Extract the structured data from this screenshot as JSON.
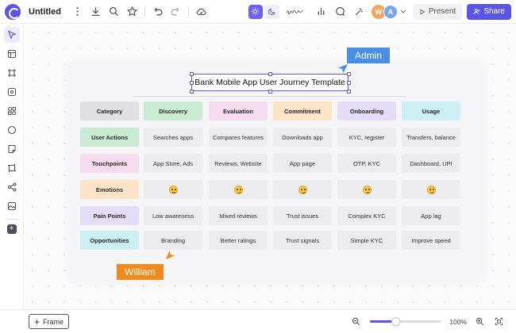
{
  "header": {
    "title": "Untitled",
    "present_label": "Present",
    "share_label": "Share",
    "avatars": [
      {
        "initial": "W",
        "color": "#f0a860"
      },
      {
        "initial": "A",
        "color": "#7aa6f0"
      }
    ]
  },
  "board": {
    "title": "Bank Mobile App User Journey Template",
    "columns": [
      {
        "label": "Category",
        "color": "#e0e0e3"
      },
      {
        "label": "Discovery",
        "color": "#c9ebd4"
      },
      {
        "label": "Evaluation",
        "color": "#f7dcef"
      },
      {
        "label": "Commitment",
        "color": "#fde3c8"
      },
      {
        "label": "Onboarding",
        "color": "#e5dcf7"
      },
      {
        "label": "Usage",
        "color": "#cdeff3"
      }
    ],
    "rows": [
      {
        "label": "User Actions",
        "color": "#c9ebd4",
        "cells": [
          "Searches apps",
          "Compares features",
          "Downloads app",
          "KYC, register",
          "Transfers, balance"
        ]
      },
      {
        "label": "Touchpoints",
        "color": "#f7dcef",
        "cells": [
          "App Store, Ads",
          "Reviews, Website",
          "App page",
          "OTP, KYC",
          "Dashboard, UPI"
        ]
      },
      {
        "label": "Emotions",
        "color": "#fde3c8",
        "emotions": [
          "think",
          "happy",
          "happy",
          "sad",
          "happy"
        ]
      },
      {
        "label": "Pain Points",
        "color": "#e5dcf7",
        "cells": [
          "Low awareness",
          "Mixed reviews",
          "Trust issues",
          "Complex KYC",
          "App lag"
        ]
      },
      {
        "label": "Opportunities",
        "color": "#cdeff3",
        "cells": [
          "Branding",
          "Better ratings",
          "Trust signals",
          "Simple KYC",
          "Improve speed"
        ]
      }
    ]
  },
  "collaborators": {
    "admin": {
      "name": "Admin",
      "color": "#4a8fe6"
    },
    "william": {
      "name": "William",
      "color": "#f08a1c"
    }
  },
  "bottom": {
    "frame_label": "Frame",
    "zoom_text": "100%",
    "zoom_fraction": 0.35
  },
  "colors": {
    "accent": "#5a55e6"
  }
}
